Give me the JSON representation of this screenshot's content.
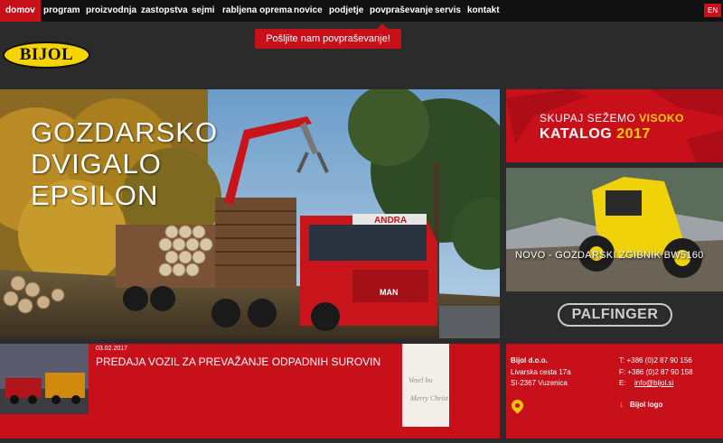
{
  "nav": {
    "items": [
      "domov",
      "program",
      "proizvodnja",
      "zastopstva",
      "sejmi",
      "rabljena oprema",
      "novice",
      "podjetje",
      "povpraševanje",
      "servis",
      "kontakt"
    ],
    "active_index": 0,
    "language": "EN"
  },
  "inquiry_popup": "Pošljite nam povpraševanje!",
  "logo": {
    "text": "BIJOL"
  },
  "hero": {
    "title_lines": [
      "GOZDARSKO",
      "DVIGALO",
      "EPSILON"
    ],
    "truck_sign": "ANDRA",
    "truck_brand": "MAN"
  },
  "catalog_banner": {
    "line1_prefix": "SKUPAJ SEŽEMO ",
    "line1_highlight": "VISOKO",
    "line2_prefix": "KATALOG ",
    "line2_highlight": "2017"
  },
  "skidder_banner": {
    "caption": "NOVO - GOZDARSKI ZGIBNIK BW5160"
  },
  "partner_logo": {
    "text": "PALFINGER"
  },
  "news": {
    "date": "03.02.2017",
    "title": "PREDAJA VOZIL ZA PREVAŽANJE ODPADNIH SUROVIN",
    "card_line1": "Vesel bo",
    "card_line2": "Merry Christ"
  },
  "contact": {
    "company": "Bijol d.o.o.",
    "street": "Livarska cesta 17a",
    "city": "SI-2367 Vuzenica",
    "phone": "T:  +386 (0)2 87 90 156",
    "fax": "F:  +386 (0)2 87 90 158",
    "email_label": "E:",
    "email": "info@bijol.si",
    "logo_download": "Bijol logo"
  },
  "colors": {
    "brand_red": "#c8101a",
    "brand_yellow": "#f5d400",
    "background": "#2b2b2b"
  }
}
